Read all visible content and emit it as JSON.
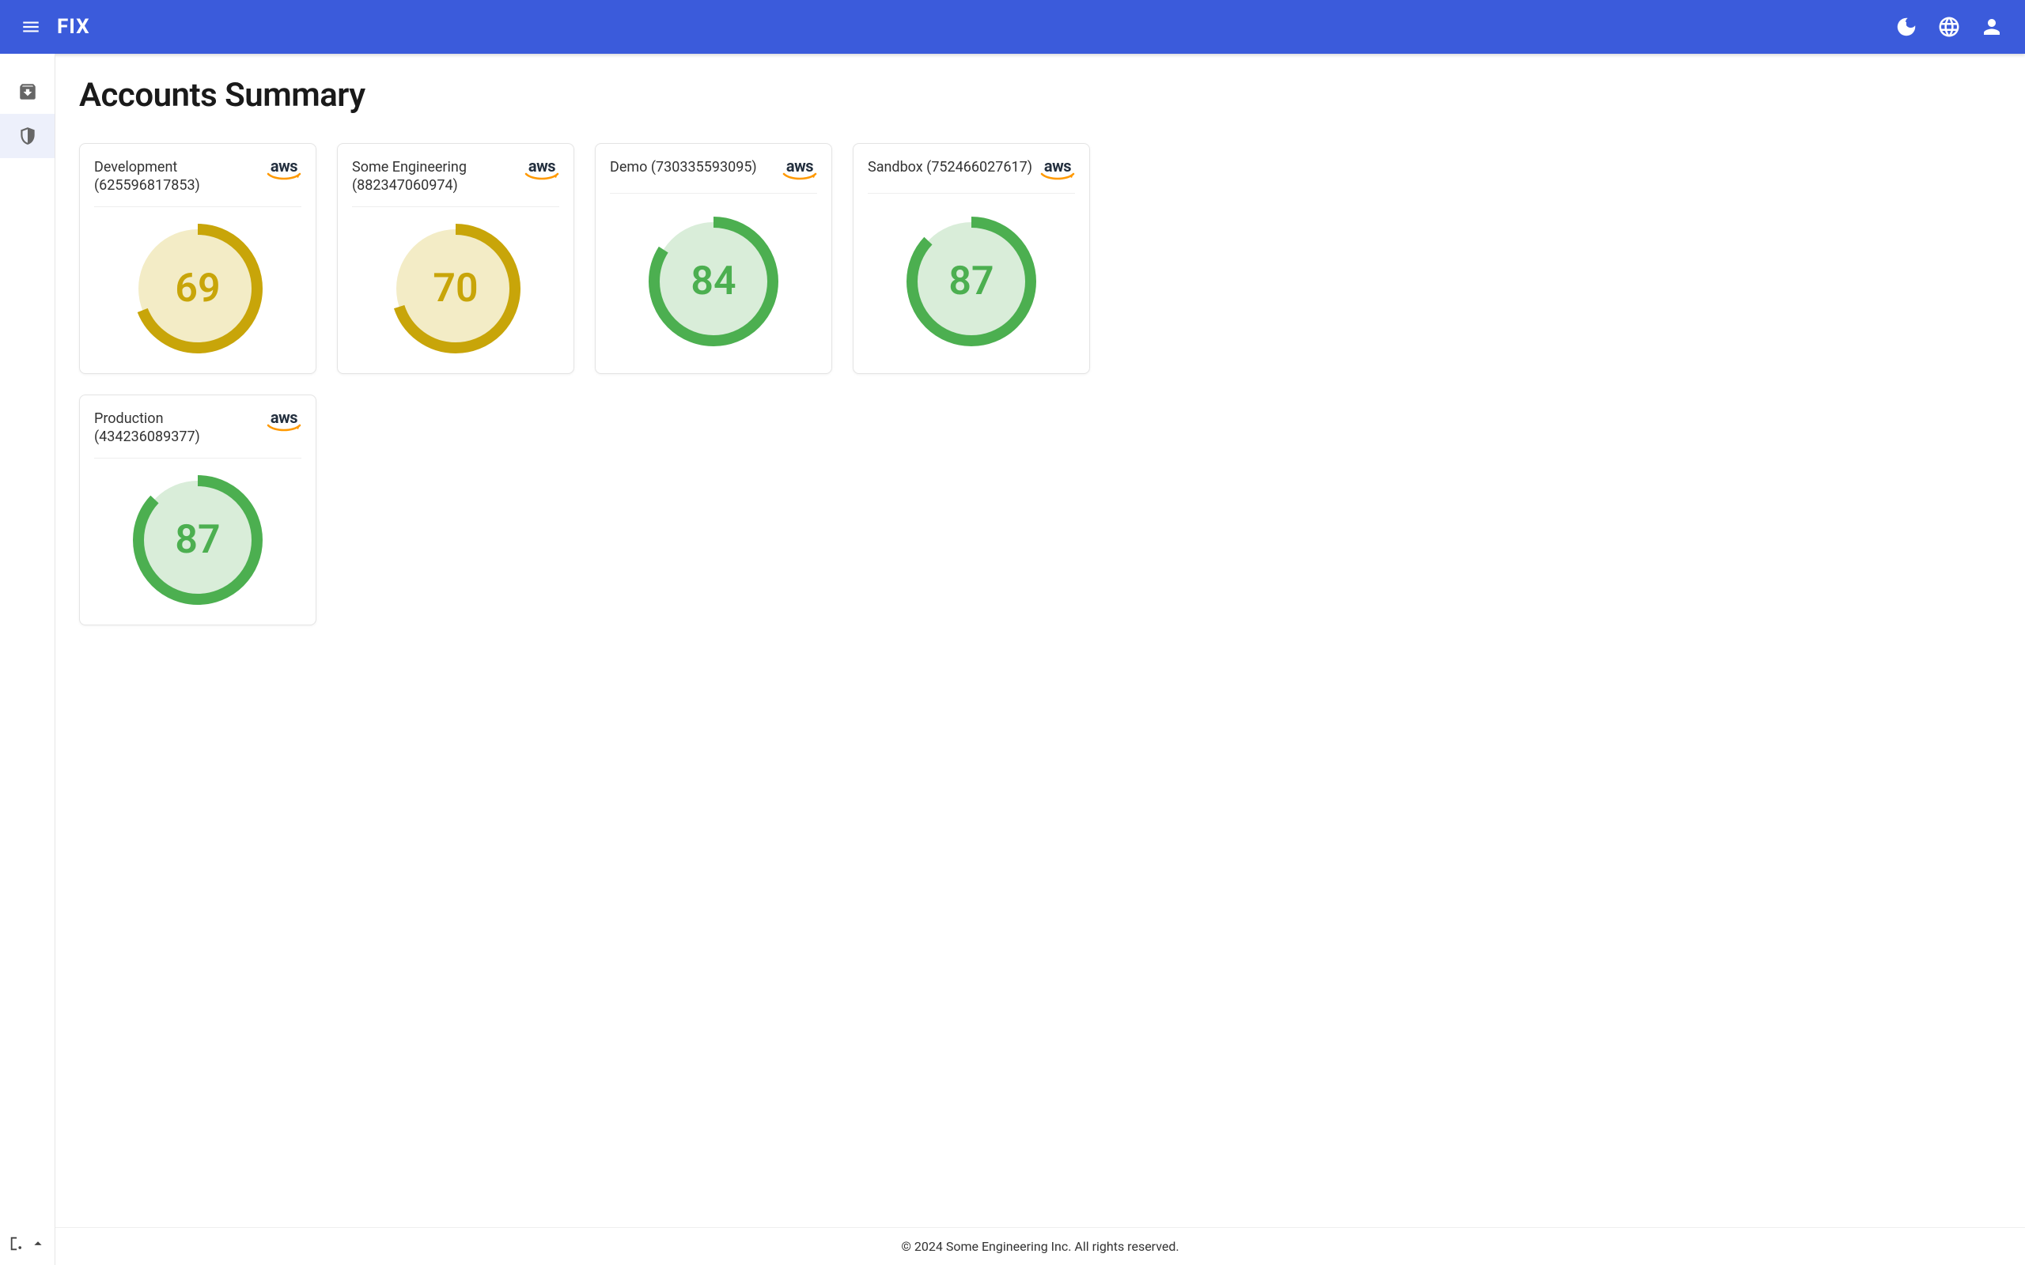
{
  "brand": "FIX",
  "page_title": "Accounts Summary",
  "footer": "© 2024 Some Engineering Inc. All rights reserved.",
  "colors": {
    "yellow": "#c8a509",
    "yellow_bg": "#f3ecc6",
    "green": "#4caf50",
    "green_bg": "#d9edd9"
  },
  "accounts": [
    {
      "name": "Development",
      "id": "625596817853",
      "score": 69,
      "provider": "aws",
      "color": "yellow"
    },
    {
      "name": "Some Engineering",
      "id": "882347060974",
      "score": 70,
      "provider": "aws",
      "color": "yellow"
    },
    {
      "name": "Demo",
      "id": "730335593095",
      "score": 84,
      "provider": "aws",
      "color": "green"
    },
    {
      "name": "Sandbox",
      "id": "752466027617",
      "score": 87,
      "provider": "aws",
      "color": "green"
    },
    {
      "name": "Production",
      "id": "434236089377",
      "score": 87,
      "provider": "aws",
      "color": "green"
    }
  ],
  "chart_data": {
    "type": "gauge-group",
    "value_range": [
      0,
      100
    ],
    "items": [
      {
        "label": "Development (625596817853)",
        "value": 69
      },
      {
        "label": "Some Engineering (882347060974)",
        "value": 70
      },
      {
        "label": "Demo (730335593095)",
        "value": 84
      },
      {
        "label": "Sandbox (752466027617)",
        "value": 87
      },
      {
        "label": "Production (434236089377)",
        "value": 87
      }
    ]
  }
}
